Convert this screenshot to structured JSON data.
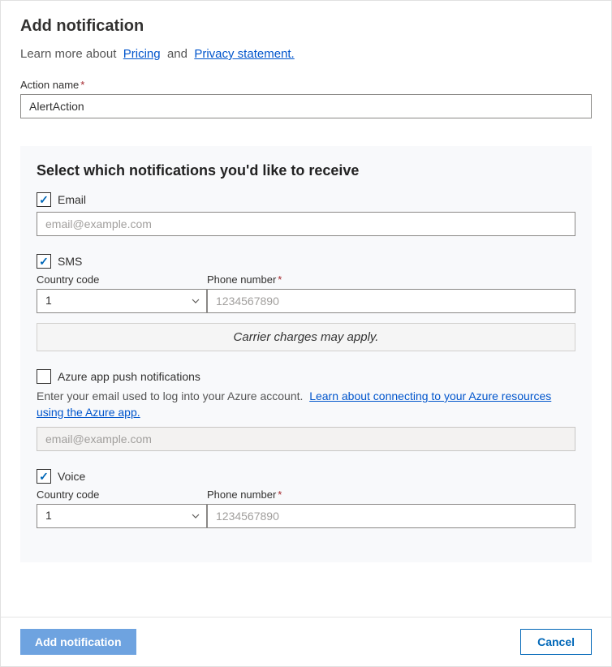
{
  "header": {
    "title": "Add notification",
    "intro_prefix": "Learn more about",
    "link_pricing": "Pricing",
    "intro_and": "and",
    "link_privacy": " Privacy statement."
  },
  "action_name": {
    "label": "Action name",
    "value": "AlertAction"
  },
  "panel": {
    "heading": "Select which notifications you'd like to receive",
    "email": {
      "checked": true,
      "label": "Email",
      "placeholder": "email@example.com",
      "value": ""
    },
    "sms": {
      "checked": true,
      "label": "SMS",
      "country_label": "Country code",
      "country_value": "1",
      "phone_label": "Phone number",
      "phone_placeholder": "1234567890",
      "phone_value": "",
      "carrier_notice": "Carrier charges may apply."
    },
    "azure_push": {
      "checked": false,
      "label": "Azure app push notifications",
      "help_prefix": "Enter your email used to log into your Azure account.",
      "help_link": "Learn about connecting to your Azure resources using the Azure app.",
      "placeholder": "email@example.com",
      "value": ""
    },
    "voice": {
      "checked": true,
      "label": "Voice",
      "country_label": "Country code",
      "country_value": "1",
      "phone_label": "Phone number",
      "phone_placeholder": "1234567890",
      "phone_value": ""
    }
  },
  "footer": {
    "primary": "Add notification",
    "secondary": "Cancel"
  }
}
